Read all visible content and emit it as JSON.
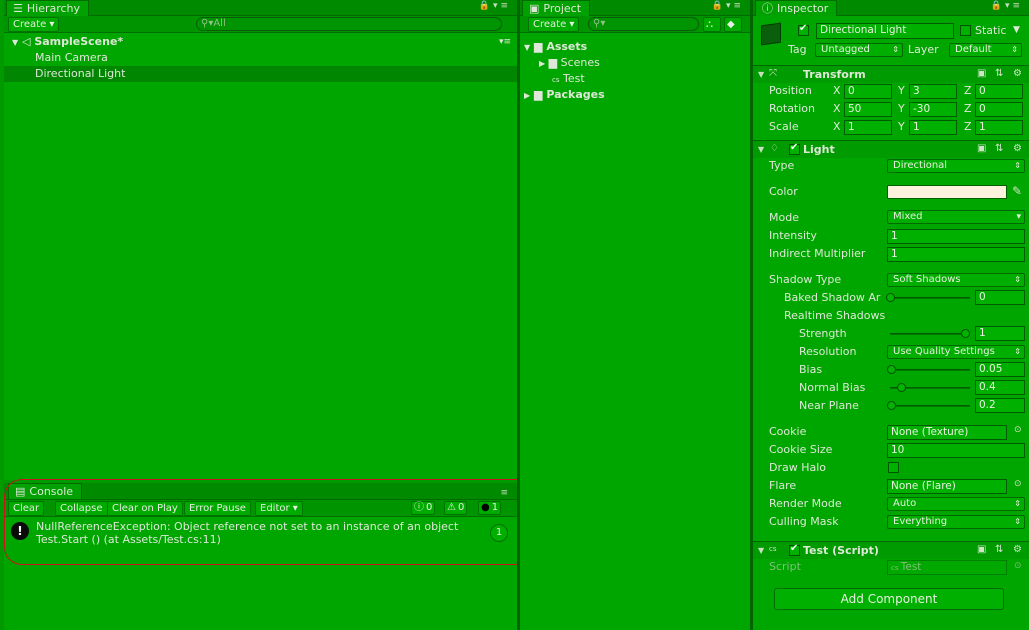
{
  "hierarchy": {
    "tab_label": "Hierarchy",
    "create_label": "Create",
    "search_placeholder": "All",
    "scene_name": "SampleScene*",
    "items": [
      "Main Camera",
      "Directional Light"
    ]
  },
  "project": {
    "tab_label": "Project",
    "create_label": "Create",
    "tree": {
      "assets": "Assets",
      "scenes": "Scenes",
      "test": "Test",
      "packages": "Packages"
    }
  },
  "console": {
    "tab_label": "Console",
    "buttons": [
      "Clear",
      "Collapse",
      "Clear on Play",
      "Error Pause",
      "Editor"
    ],
    "counts": {
      "info": "0",
      "warn": "0",
      "error": "1"
    },
    "message_line1": "NullReferenceException: Object reference not set to an instance of an object",
    "message_line2": "Test.Start () (at Assets/Test.cs:11)",
    "collapse_count": "1"
  },
  "inspector": {
    "tab_label": "Inspector",
    "object_name": "Directional Light",
    "static_label": "Static",
    "tag_label": "Tag",
    "tag_value": "Untagged",
    "layer_label": "Layer",
    "layer_value": "Default",
    "transform": {
      "title": "Transform",
      "position_label": "Position",
      "rotation_label": "Rotation",
      "scale_label": "Scale",
      "position": {
        "x": "0",
        "y": "3",
        "z": "0"
      },
      "rotation": {
        "x": "50",
        "y": "-30",
        "z": "0"
      },
      "scale": {
        "x": "1",
        "y": "1",
        "z": "1"
      }
    },
    "light": {
      "title": "Light",
      "type_label": "Type",
      "type_value": "Directional",
      "color_label": "Color",
      "color_value": "#fdf2dd",
      "mode_label": "Mode",
      "mode_value": "Mixed",
      "intensity_label": "Intensity",
      "intensity_value": "1",
      "indirect_label": "Indirect Multiplier",
      "indirect_value": "1",
      "shadow_type_label": "Shadow Type",
      "shadow_type_value": "Soft Shadows",
      "baked_label": "Baked Shadow Ar",
      "baked_value": "0",
      "realtime_label": "Realtime Shadows",
      "strength_label": "Strength",
      "strength_value": "1",
      "resolution_label": "Resolution",
      "resolution_value": "Use Quality Settings",
      "bias_label": "Bias",
      "bias_value": "0.05",
      "normal_bias_label": "Normal Bias",
      "normal_bias_value": "0.4",
      "near_plane_label": "Near Plane",
      "near_plane_value": "0.2",
      "cookie_label": "Cookie",
      "cookie_value": "None (Texture)",
      "cookie_size_label": "Cookie Size",
      "cookie_size_value": "10",
      "draw_halo_label": "Draw Halo",
      "flare_label": "Flare",
      "flare_value": "None (Flare)",
      "render_mode_label": "Render Mode",
      "render_mode_value": "Auto",
      "culling_label": "Culling Mask",
      "culling_value": "Everything"
    },
    "script": {
      "title": "Test (Script)",
      "script_label": "Script",
      "script_value": "Test"
    },
    "add_component_label": "Add Component"
  },
  "colors": {
    "background": "#00a600",
    "highlight_outline": "#c8141a"
  }
}
